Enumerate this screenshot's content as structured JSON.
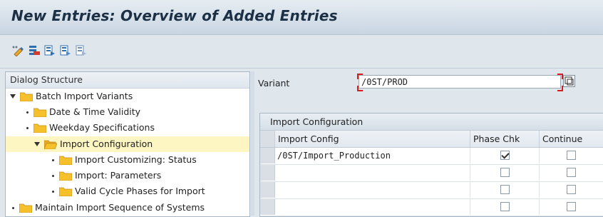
{
  "window": {
    "title": "New Entries: Overview of Added Entries"
  },
  "toolbar": {
    "icons": [
      "change-display-icon",
      "delete-icon",
      "select-all-icon",
      "select-block-icon",
      "deselect-all-icon"
    ]
  },
  "dialog_structure": {
    "header": "Dialog Structure",
    "items": [
      {
        "label": "Batch Import Variants",
        "expanded": true,
        "level": 0
      },
      {
        "label": "Date & Time Validity",
        "level": 1
      },
      {
        "label": "Weekday Specifications",
        "level": 1
      },
      {
        "label": "Import Configuration",
        "expanded": true,
        "selected": true,
        "level": 1
      },
      {
        "label": "Import Customizing: Status",
        "level": 2
      },
      {
        "label": "Import: Parameters",
        "level": 2
      },
      {
        "label": "Valid Cycle Phases for Import",
        "level": 2
      },
      {
        "label": "Maintain Import Sequence of Systems",
        "level": 0
      }
    ]
  },
  "variant": {
    "label": "Variant",
    "value": "/0ST/PROD"
  },
  "table": {
    "caption": "Import Configuration",
    "columns": [
      "Import Config",
      "Phase Chk",
      "Continue"
    ],
    "rows": [
      {
        "import_config": "/0ST/Import_Production",
        "phase_chk": true,
        "continue": false
      },
      {
        "import_config": "",
        "phase_chk": false,
        "continue": false
      },
      {
        "import_config": "",
        "phase_chk": false,
        "continue": false
      },
      {
        "import_config": "",
        "phase_chk": false,
        "continue": false
      }
    ]
  },
  "colors": {
    "selected_row": "#fdf6c3",
    "folder": "#f6c02c",
    "title_text": "#1b2f45"
  }
}
